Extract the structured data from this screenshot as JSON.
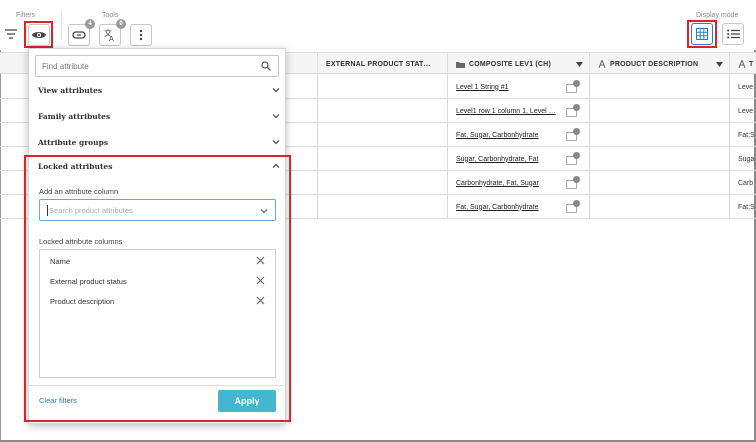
{
  "toolbar": {
    "filters_label": "Filters",
    "tools_label": "Tools",
    "display_mode_label": "Display mode",
    "link_badge": "4",
    "translate_badge": "0",
    "icons": [
      "filter-icon",
      "eye-icon",
      "link-icon",
      "translate-icon",
      "more-vertical-icon",
      "grid-view-icon",
      "list-view-icon"
    ]
  },
  "grid": {
    "columns": [
      {
        "label": "",
        "icon": ""
      },
      {
        "label": "EXTERNAL PRODUCT STAT…",
        "icon": ""
      },
      {
        "label": "COMPOSITE LEV1 (CH)",
        "icon": "folder-icon"
      },
      {
        "label": "PRODUCT DESCRIPTION",
        "icon": "text-icon"
      },
      {
        "label": "T",
        "icon": "text-icon"
      }
    ],
    "rows": [
      {
        "composite": "Level 1 String #1",
        "last": "Leve"
      },
      {
        "composite": "Level1 row 1 column 1, Level …",
        "last": "Leve"
      },
      {
        "composite": "Fat, Sugar, Carbonhydrate",
        "last": "Fat;S"
      },
      {
        "composite": "Sugar, Carbonhydrate, Fat",
        "last": "Suga"
      },
      {
        "composite": "Carbonhydrate, Fat, Sugar",
        "last": "Carb"
      },
      {
        "composite": "Fat, Sugar, Carbonhydrate",
        "last": "Fat;S"
      }
    ]
  },
  "panel": {
    "find_placeholder": "Find attribute",
    "sections": [
      "View attributes",
      "Family attributes",
      "Attribute groups",
      "Locked attributes"
    ],
    "add_column_label": "Add an attribute column",
    "select_placeholder": "Search product attributes",
    "locked_columns_label": "Locked attribute columns",
    "locked_items": [
      "Name",
      "External product status",
      "Product description"
    ],
    "clear_label": "Clear filters",
    "apply_label": "Apply"
  },
  "colors": {
    "highlight": "#d9232d",
    "accent": "#45b6d0",
    "link": "#2a7fbe"
  }
}
